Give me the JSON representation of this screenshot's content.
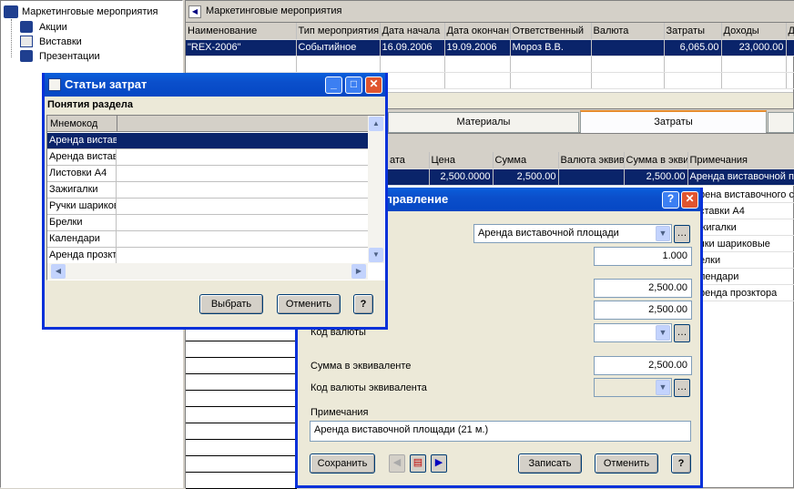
{
  "tree": {
    "root": "Маркетинговые мероприятия",
    "children": [
      "Акции",
      "Виставки",
      "Презентации"
    ]
  },
  "top_panel": {
    "title": "Маркетинговые мероприятия",
    "columns": [
      "Наименование",
      "Тип мероприятия",
      "Дата начала",
      "Дата окончан",
      "Ответственный",
      "Валюта",
      "Затраты",
      "Доходы",
      "Д"
    ],
    "row": [
      "\"REX-2006\"",
      "Событийное",
      "16.09.2006",
      "19.09.2006",
      "Мороз В.В.",
      "",
      "6,065.00",
      "23,000.00",
      ""
    ]
  },
  "tabs": [
    "Материалы",
    "Затраты"
  ],
  "lower_grid": {
    "columns": [
      "ата",
      "Цена",
      "Сумма",
      "Валюта эквив",
      "Сумма в экви",
      "Примечания"
    ],
    "first_row": [
      "",
      "2,500.0000",
      "2,500.00",
      "",
      "2,500.00",
      "Аренда виставочной пл"
    ],
    "notes": [
      "рена виставочного с",
      "ставки А4",
      "жигалки",
      "чки шариковые",
      "елки",
      "лендари",
      "ренда прозктора"
    ]
  },
  "edit_dialog": {
    "title": "правление",
    "expense_item": "Аренда виставочной площади",
    "quantity": "1.000",
    "price": "2,500.00",
    "amount": "2,500.00",
    "currency_code_label": "Код валюты",
    "equiv_amount_label": "Сумма в эквиваленте",
    "equiv_amount": "2,500.00",
    "equiv_currency_label": "Код валюты эквивалента",
    "notes_label": "Примечания",
    "notes": "Аренда виставочной площади  (21 м.)",
    "save": "Сохранить",
    "write": "Записать",
    "cancel": "Отменить",
    "help": "?"
  },
  "popup": {
    "title": "Статьи затрат",
    "section": "Понятия раздела",
    "column": "Мнемокод",
    "items": [
      "Аренда вистав",
      "Аренда вистав",
      "Листовки А4",
      "Зажигалки",
      "Ручки шарикові",
      "Брелки",
      "Календари",
      "Аренда прозкт"
    ],
    "select": "Выбрать",
    "cancel": "Отменить",
    "help": "?"
  }
}
